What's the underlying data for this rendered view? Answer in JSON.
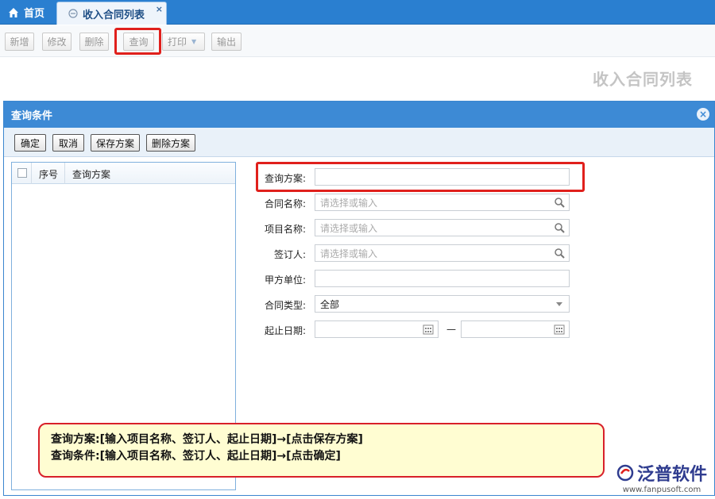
{
  "tabs": {
    "home_label": "首页",
    "active_label": "收入合同列表",
    "close_glyph": "×"
  },
  "toolbar": {
    "buttons": [
      "新增",
      "修改",
      "删除",
      "查询",
      "打印",
      "输出"
    ],
    "print_arrow": "▼"
  },
  "page_title": "收入合同列表",
  "dialog": {
    "title": "查询条件",
    "close_glyph": "×",
    "buttons": [
      "确定",
      "取消",
      "保存方案",
      "删除方案"
    ],
    "list_headers": [
      "序号",
      "查询方案"
    ],
    "form": {
      "scheme": {
        "label": "查询方案:",
        "value": ""
      },
      "contract_name": {
        "label": "合同名称:",
        "placeholder": "请选择或输入"
      },
      "project_name": {
        "label": "项目名称:",
        "placeholder": "请选择或输入"
      },
      "signer": {
        "label": "签订人:",
        "placeholder": "请选择或输入"
      },
      "party_a": {
        "label": "甲方单位:",
        "value": ""
      },
      "contract_type": {
        "label": "合同类型:",
        "value": "全部"
      },
      "date_range": {
        "label": "起止日期:",
        "separator": "—"
      }
    }
  },
  "callout": {
    "line1": "查询方案:[输入项目名称、签订人、起止日期]→[点击保存方案]",
    "line2": "查询条件:[输入项目名称、签订人、起止日期]→[点击确定]"
  },
  "logo": {
    "name": "泛普软件",
    "url": "www.fanpusoft.com"
  },
  "colors": {
    "tabbar": "#2a7fd0",
    "dialog_header": "#3d8ad5",
    "highlight": "#e0201c",
    "callout_bg": "#fffdd2"
  }
}
